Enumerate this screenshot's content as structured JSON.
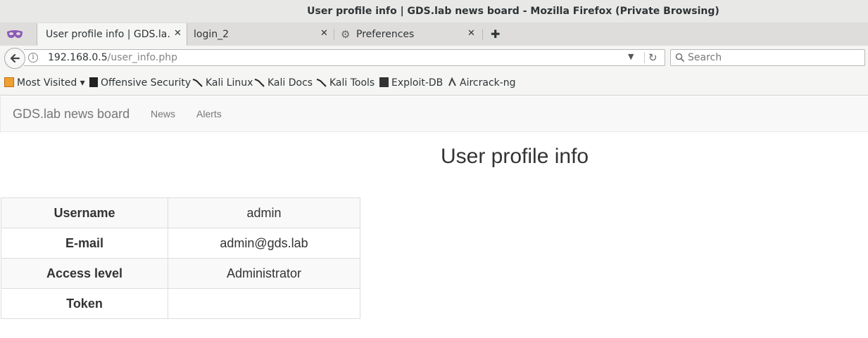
{
  "window": {
    "title": "User profile info | GDS.lab news board - Mozilla Firefox (Private Browsing)"
  },
  "tabs": [
    {
      "label": "User profile info | GDS.la…",
      "active": true
    },
    {
      "label": "login_2",
      "active": false
    },
    {
      "label": "Preferences",
      "active": false
    }
  ],
  "navbar": {
    "url_host": "192.168.0.5",
    "url_path": "/user_info.php",
    "search_placeholder": "Search"
  },
  "bookmarks": [
    {
      "label": "Most Visited ▾",
      "icon": "most-visited-icon"
    },
    {
      "label": "Offensive Security",
      "icon": "offsec-icon"
    },
    {
      "label": "Kali Linux",
      "icon": "kali-icon"
    },
    {
      "label": "Kali Docs",
      "icon": "kali-icon"
    },
    {
      "label": "Kali Tools",
      "icon": "kali-icon"
    },
    {
      "label": "Exploit-DB",
      "icon": "exploitdb-icon"
    },
    {
      "label": "Aircrack-ng",
      "icon": "aircrack-icon"
    }
  ],
  "site": {
    "brand": "GDS.lab news board",
    "links": [
      "News",
      "Alerts"
    ]
  },
  "main": {
    "title": "User profile info",
    "rows": [
      {
        "key": "Username",
        "value": "admin"
      },
      {
        "key": "E-mail",
        "value": "admin@gds.lab"
      },
      {
        "key": "Access level",
        "value": "Administrator"
      },
      {
        "key": "Token",
        "value": ""
      }
    ]
  },
  "colors": {
    "chrome_bg": "#e8e8e7",
    "toolbar_bg": "#f5f5f4",
    "site_nav_bg": "#f8f8f8",
    "table_stripe": "#f9f9f9"
  }
}
